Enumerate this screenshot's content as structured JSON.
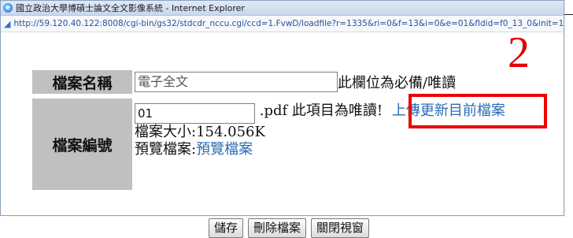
{
  "window": {
    "title": "國立政治大學博碩士論文全文影像系統 - Internet Explorer",
    "url": "http://59.120.40.122:8008/cgi-bin/gs32/stdcdr_nccu.cgi/ccd=1.FvwD/loadfile?r=1335&ri=0&f=13&i=0&e=01&fldid=f0_13_0&init=1"
  },
  "form": {
    "file_name_label": "檔案名稱",
    "file_name_value": "電子全文",
    "file_name_note": "此欄位為必備/唯讀",
    "file_no_label": "檔案編號",
    "file_no_value": "01",
    "file_no_note": ".pdf 此項目為唯讀!",
    "upload_link": "上傳更新目前檔案",
    "size_label": "檔案大小:",
    "size_value": "154.056K",
    "preview_label": "預覽檔案:",
    "preview_link": "預覽檔案"
  },
  "buttons": {
    "save": "儲存",
    "delete": "刪除檔案",
    "close": "關閉視窗"
  },
  "annotation": {
    "step_number": "2",
    "color": "#ee0000"
  }
}
